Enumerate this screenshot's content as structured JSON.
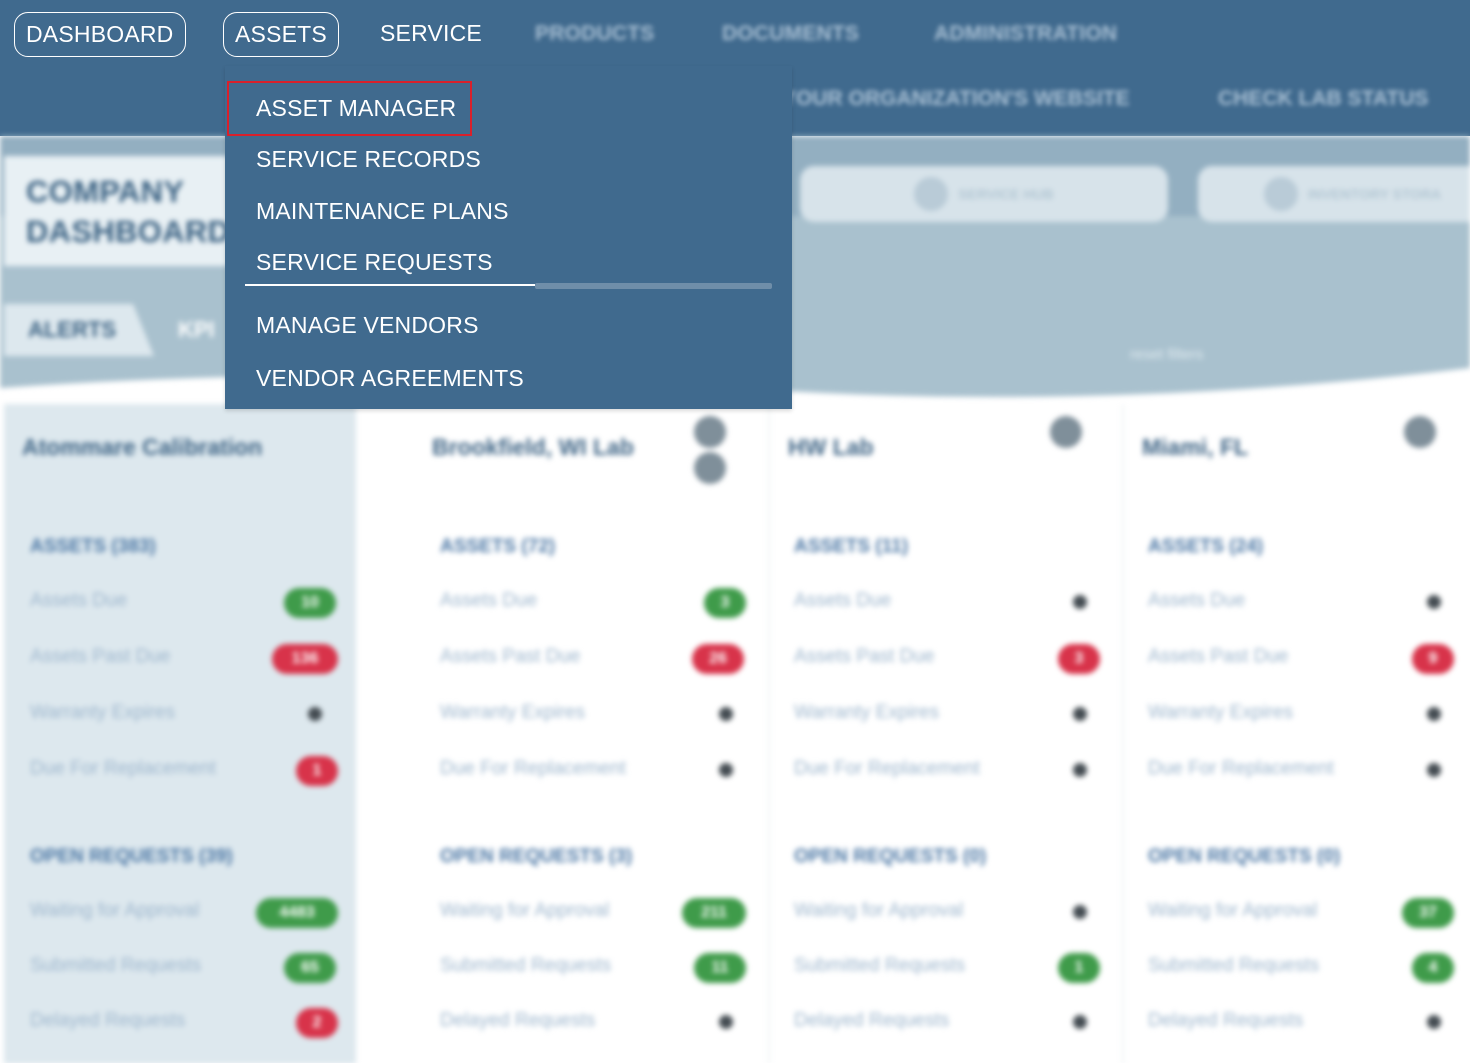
{
  "nav": {
    "items": [
      {
        "label": "DASHBOARD"
      },
      {
        "label": "ASSETS"
      },
      {
        "label": "SERVICE"
      },
      {
        "label": "PRODUCTS"
      },
      {
        "label": "DOCUMENTS"
      },
      {
        "label": "ADMINISTRATION"
      }
    ]
  },
  "subnav": {
    "website": "YOUR ORGANIZATION'S WEBSITE",
    "lab_status": "CHECK LAB STATUS"
  },
  "dropdown": {
    "items": [
      {
        "label": "ASSET MANAGER"
      },
      {
        "label": "SERVICE RECORDS"
      },
      {
        "label": "MAINTENANCE PLANS"
      },
      {
        "label": "SERVICE REQUESTS"
      },
      {
        "label": "MANAGE VENDORS"
      },
      {
        "label": "VENDOR AGREEMENTS"
      }
    ]
  },
  "dashboard": {
    "title_line1": "COMPANY",
    "title_line2": "DASHBOARD",
    "tabs": [
      {
        "label": "ALERTS"
      },
      {
        "label": "KPI"
      }
    ],
    "quick_buttons": [
      {
        "label": "SERVICE HUB"
      },
      {
        "label": "INVENTORY STORA"
      }
    ],
    "reset_filters": "reset filters"
  },
  "locations": [
    {
      "name": "Atommare Calibration",
      "assets_header": "ASSETS (383)",
      "assets": [
        {
          "label": "Assets Due",
          "value": "10",
          "color": "green"
        },
        {
          "label": "Assets Past Due",
          "value": "136",
          "color": "red"
        },
        {
          "label": "Warranty Expires",
          "value": "",
          "color": "none"
        },
        {
          "label": "Due For Replacement",
          "value": "1",
          "color": "red"
        }
      ],
      "requests_header": "OPEN REQUESTS (39)",
      "requests": [
        {
          "label": "Waiting for Approval",
          "value": "4483",
          "color": "green"
        },
        {
          "label": "Submitted Requests",
          "value": "65",
          "color": "green"
        },
        {
          "label": "Delayed Requests",
          "value": "2",
          "color": "red"
        }
      ]
    },
    {
      "name": "Brookfield, WI Lab",
      "assets_header": "ASSETS (72)",
      "assets": [
        {
          "label": "Assets Due",
          "value": "3",
          "color": "green"
        },
        {
          "label": "Assets Past Due",
          "value": "26",
          "color": "red"
        },
        {
          "label": "Warranty Expires",
          "value": "",
          "color": "none"
        },
        {
          "label": "Due For Replacement",
          "value": "",
          "color": "none"
        }
      ],
      "requests_header": "OPEN REQUESTS (3)",
      "requests": [
        {
          "label": "Waiting for Approval",
          "value": "211",
          "color": "green"
        },
        {
          "label": "Submitted Requests",
          "value": "11",
          "color": "green"
        },
        {
          "label": "Delayed Requests",
          "value": "",
          "color": "none"
        }
      ]
    },
    {
      "name": "HW Lab",
      "assets_header": "ASSETS (11)",
      "assets": [
        {
          "label": "Assets Due",
          "value": "",
          "color": "none"
        },
        {
          "label": "Assets Past Due",
          "value": "3",
          "color": "red"
        },
        {
          "label": "Warranty Expires",
          "value": "",
          "color": "none"
        },
        {
          "label": "Due For Replacement",
          "value": "",
          "color": "none"
        }
      ],
      "requests_header": "OPEN REQUESTS (0)",
      "requests": [
        {
          "label": "Waiting for Approval",
          "value": "",
          "color": "none"
        },
        {
          "label": "Submitted Requests",
          "value": "1",
          "color": "green"
        },
        {
          "label": "Delayed Requests",
          "value": "",
          "color": "none"
        }
      ]
    },
    {
      "name": "Miami, FL",
      "assets_header": "ASSETS (24)",
      "assets": [
        {
          "label": "Assets Due",
          "value": "",
          "color": "none"
        },
        {
          "label": "Assets Past Due",
          "value": "9",
          "color": "red"
        },
        {
          "label": "Warranty Expires",
          "value": "",
          "color": "none"
        },
        {
          "label": "Due For Replacement",
          "value": "",
          "color": "none"
        }
      ],
      "requests_header": "OPEN REQUESTS (0)",
      "requests": [
        {
          "label": "Waiting for Approval",
          "value": "37",
          "color": "green"
        },
        {
          "label": "Submitted Requests",
          "value": "4",
          "color": "green"
        },
        {
          "label": "Delayed Requests",
          "value": "",
          "color": "none"
        }
      ]
    }
  ]
}
